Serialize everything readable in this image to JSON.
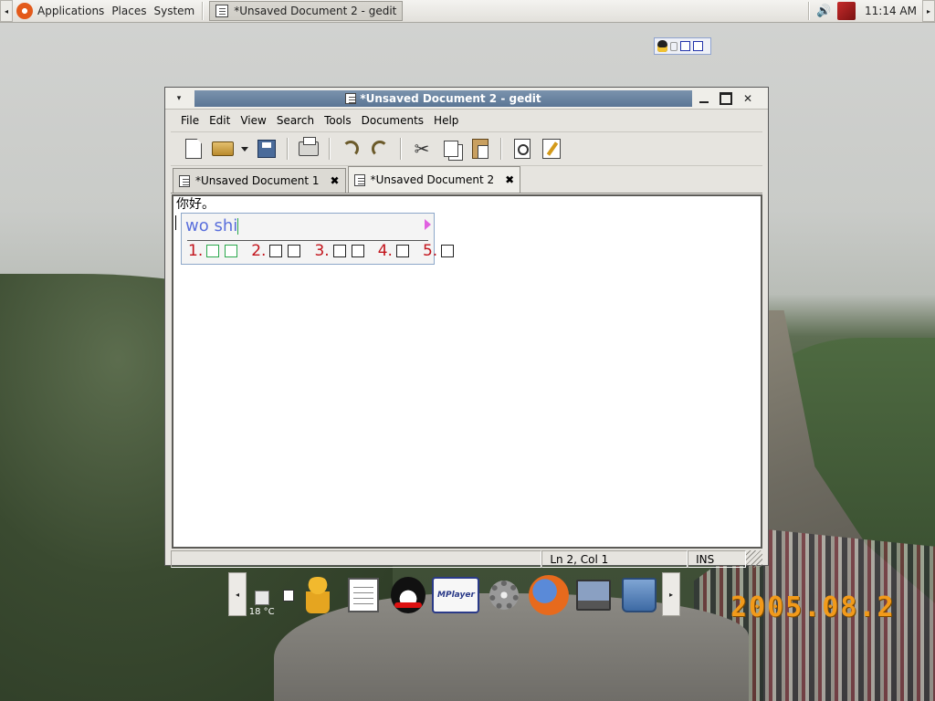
{
  "top_panel": {
    "left_arrow": "◂",
    "right_arrow": "▸",
    "menus": [
      "Applications",
      "Places",
      "System"
    ],
    "taskbar_window": "*Unsaved Document 2 - gedit",
    "clock": "11:14 AM",
    "volume_glyph": "🔊",
    "icons": [
      "ubuntu-logo-icon",
      "volume-icon",
      "logout-icon"
    ]
  },
  "window": {
    "title": "*Unsaved Document 2 - gedit",
    "menu_glyph": "▾",
    "close_glyph": "✕",
    "menubar": [
      "File",
      "Edit",
      "View",
      "Search",
      "Tools",
      "Documents",
      "Help"
    ],
    "toolbar_icons": [
      "new-document-icon",
      "open-folder-icon",
      "open-recent-dropdown-icon",
      "save-icon",
      "print-icon",
      "undo-icon",
      "redo-icon",
      "cut-icon",
      "copy-icon",
      "paste-icon",
      "find-icon",
      "find-replace-icon"
    ],
    "cut_glyph": "✂",
    "tabs": [
      {
        "label": "*Unsaved Document 1",
        "close": "✖",
        "active": false
      },
      {
        "label": "*Unsaved Document 2",
        "close": "✖",
        "active": true
      }
    ],
    "editor_text": "你好。",
    "ime": {
      "preedit": "wo shi",
      "candidates": [
        "1.",
        "2.",
        "3.",
        "4.",
        "5."
      ]
    },
    "status": {
      "message": "",
      "position": "Ln 2, Col 1",
      "mode": "INS"
    }
  },
  "dock": {
    "left_arrow": "◂",
    "right_arrow": "▸",
    "weather": "18 °C",
    "mplayer_label": "MPlayer",
    "items": [
      "weather-icon",
      "note-icon",
      "figure-icon",
      "notepad-icon",
      "qq-penguin-icon",
      "mplayer-icon",
      "settings-gear-icon",
      "firefox-icon",
      "computer-icon",
      "trash-icon"
    ]
  },
  "desktop": {
    "photo_date": "2005.08.2"
  },
  "colors": {
    "titlebar": "#5b7695",
    "ime_preedit": "#5a6fdc",
    "ime_candidate": "#c2141c",
    "date_stamp": "#f29a1a"
  }
}
